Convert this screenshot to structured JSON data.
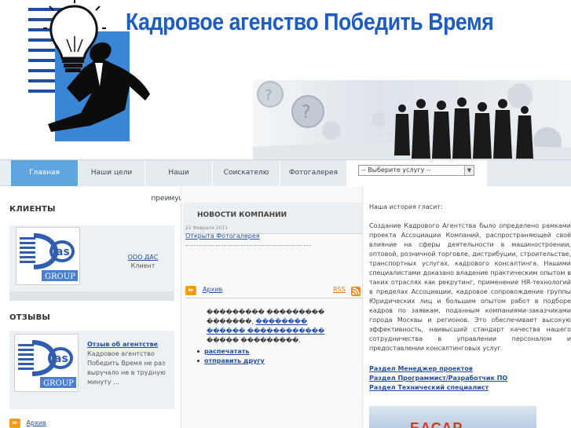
{
  "header": {
    "title": "Кадровое агенство Победить Время"
  },
  "nav": {
    "items": [
      "Главная",
      "Наши цели",
      "Наши преимущества",
      "Соискателю",
      "Фотогалерея"
    ],
    "select_value": "-- Выберите услугу --"
  },
  "clients": {
    "title": "КЛИЕНТЫ",
    "company": "ООО ДАС",
    "role": "Клиент",
    "logo_text": "GROUP"
  },
  "reviews": {
    "title": "ОТЗЫВЫ",
    "link": "Отзыв об агентстве",
    "text_lines": [
      "Кадровое агентство",
      "Победить Время не раз",
      "выручало не в трудную",
      "минуту ..."
    ],
    "archive": "Архив"
  },
  "news": {
    "title": "НОВОСТИ КОМПАНИИ",
    "date": "22 Февраля 2011",
    "headline": "Открыта Фотогалерея",
    "archive": "Архив",
    "rss": "RSS",
    "garbled_line1": "��������� ���������",
    "garbled_line2_pre": "�������, ",
    "garbled_link1": "��������",
    "garbled_link2": "������ ������������",
    "garbled_line4": "����� ���������.",
    "bullets": [
      "распечатать",
      "отправить другу"
    ]
  },
  "about": {
    "intro": "Наша история гласит:",
    "body": "Создание Кадрового Агентства было определено рамками проекта Ассоциации Компаний, распространяющей своё влияние на сферы деятельности в машиностроении, оптовой, розничной торговле, дистрибуции, строительстве, транспортных услугах, кадрового консалтинга. Нашими специалистами доказано владение практическим опытом в таких отраслях как рекрутинг, применение HR-технологий в пределах Ассоциации, кадровое сопровождение группы Юридических лиц и большим опытом работ в подборе кадров по заявкам, поданным компаниями-заказчиками города Москвы и регионов. Это обеспечивает высокую эффективность, наивысший стандарт качества нашего сотрудничества в управлении персоналом и предоставлении консалтинговых услуг.",
    "links": [
      "Раздел Менеджер проектов",
      "Раздел Программист/Разработчик ПО",
      "Раздел Технический специалист"
    ],
    "bottom_banner_text": "БАСАР"
  },
  "colors": {
    "title_blue": "#1f5cc0",
    "nav_active": "#5fa6e0",
    "link_blue": "#1f4fa8",
    "accent_orange": "#f2a21a"
  }
}
